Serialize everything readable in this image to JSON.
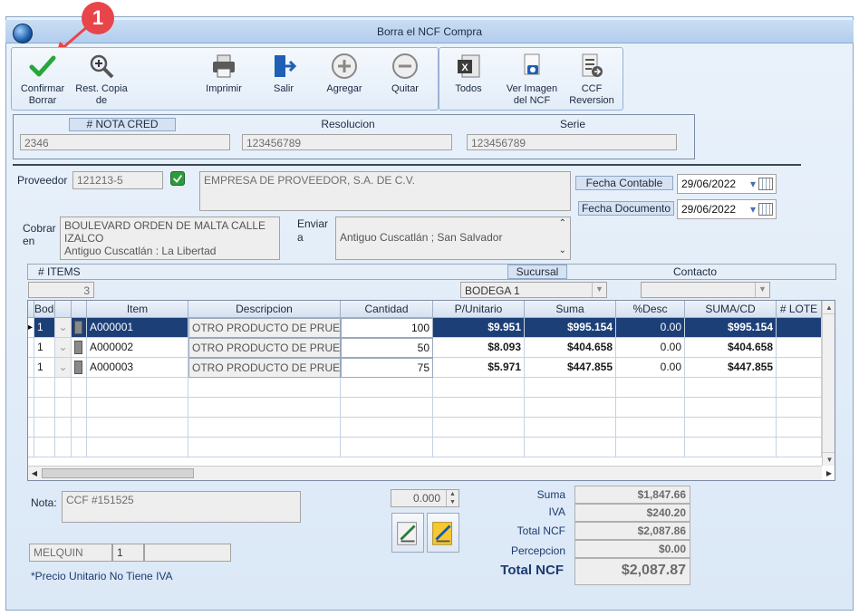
{
  "window": {
    "title": "Borra el NCF Compra"
  },
  "callout": {
    "number": "1"
  },
  "toolbar": {
    "confirmar": "Confirmar\nBorrar",
    "rest_copia": "Rest. Copia\nde",
    "imprimir": "Imprimir",
    "salir": "Salir",
    "agregar": "Agregar",
    "quitar": "Quitar",
    "todos": "Todos",
    "ver_imagen": "Ver Imagen\ndel NCF",
    "ccf_reversion": "CCF\nReversion"
  },
  "header": {
    "nota_cred_label": "# NOTA CRED",
    "nota_cred_value": "2346",
    "resolucion_label": "Resolucion",
    "resolucion_value": "123456789",
    "serie_label": "Serie",
    "serie_value": "123456789"
  },
  "proveedor": {
    "label": "Proveedor",
    "code": "121213-5",
    "name": "EMPRESA DE PROVEEDOR, S.A. DE C.V."
  },
  "fechas": {
    "contable_label": "Fecha Contable",
    "contable_value": "29/06/2022",
    "documento_label": "Fecha Documento",
    "documento_value": "29/06/2022"
  },
  "cobrar": {
    "label": "Cobrar\nen",
    "line1": "BOULEVARD ORDEN DE MALTA CALLE",
    "line2": "IZALCO",
    "line3": "Antiguo Cuscatlán : La Libertad"
  },
  "enviar": {
    "label": "Enviar\na",
    "value": "Antiguo Cuscatlán ; San Salvador"
  },
  "items_bar": {
    "items_label": "# ITEMS",
    "items_value": "3",
    "sucursal_label": "Sucursal",
    "sucursal_value": "BODEGA 1",
    "contacto_label": "Contacto"
  },
  "grid": {
    "columns": [
      "Bodega",
      "Item",
      "Descripcion",
      "Cantidad",
      "P/Unitario",
      "Suma",
      "%Desc",
      "SUMA/CD",
      "# LOTE"
    ],
    "rows": [
      {
        "bodega": "1",
        "item": "A000001",
        "descripcion": "OTRO PRODUCTO DE PRUEBA",
        "cantidad": "100",
        "punitario": "$9.951",
        "suma": "$995.154",
        "desc": "0.00",
        "sumacd": "$995.154"
      },
      {
        "bodega": "1",
        "item": "A000002",
        "descripcion": "OTRO PRODUCTO DE PRUEBA",
        "cantidad": "50",
        "punitario": "$8.093",
        "suma": "$404.658",
        "desc": "0.00",
        "sumacd": "$404.658"
      },
      {
        "bodega": "1",
        "item": "A000003",
        "descripcion": "OTRO PRODUCTO DE PRUEBA",
        "cantidad": "75",
        "punitario": "$5.971",
        "suma": "$447.855",
        "desc": "0.00",
        "sumacd": "$447.855"
      }
    ]
  },
  "nota": {
    "label": "Nota:",
    "value": "CCF  #151525"
  },
  "user": {
    "name": "MELQUIN",
    "num": "1"
  },
  "footer_note": "*Precio Unitario No Tiene IVA",
  "spinner": {
    "value": "0.000"
  },
  "totals": {
    "suma_label": "Suma",
    "suma": "$1,847.66",
    "iva_label": "IVA",
    "iva": "$240.20",
    "total_ncf_label": "Total  NCF",
    "total_ncf": "$2,087.86",
    "percepcion_label": "Percepcion",
    "percepcion": "$0.00",
    "grand_label": "Total  NCF",
    "grand": "$2,087.87"
  },
  "colors": {
    "accent": "#1c3f78",
    "callout": "#e8454a"
  }
}
